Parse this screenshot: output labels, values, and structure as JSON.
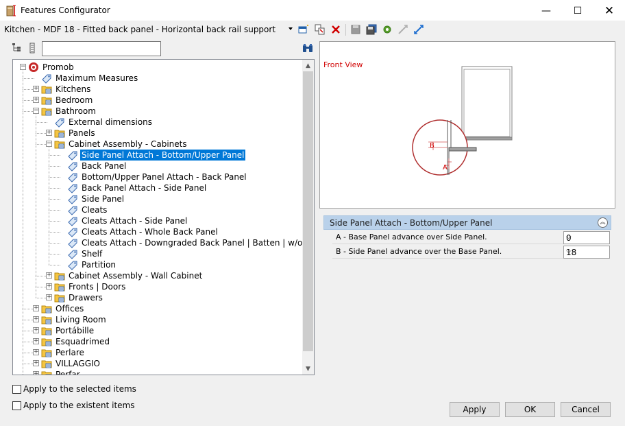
{
  "window": {
    "title": "Features Configurator",
    "minimize_glyph": "—",
    "maximize_glyph": "☐",
    "close_glyph": "✕"
  },
  "toolbar": {
    "config_name": "Kitchen - MDF 18 - Fitted back panel - Horizontal back rail support"
  },
  "tree": {
    "search_value": "",
    "nodes": [
      {
        "label": "Promob"
      },
      {
        "label": "Maximum Measures"
      },
      {
        "label": "Kitchens"
      },
      {
        "label": "Bedroom"
      },
      {
        "label": "Bathroom"
      },
      {
        "label": "External dimensions"
      },
      {
        "label": "Panels"
      },
      {
        "label": "Cabinet Assembly - Cabinets"
      },
      {
        "label": "Side Panel Attach - Bottom/Upper Panel"
      },
      {
        "label": "Back Panel"
      },
      {
        "label": " Bottom/Upper Panel Attach - Back Panel"
      },
      {
        "label": "Back Panel Attach - Side Panel"
      },
      {
        "label": "Side Panel"
      },
      {
        "label": "Cleats"
      },
      {
        "label": "Cleats Attach - Side Panel"
      },
      {
        "label": "Cleats Attach - Whole Back Panel"
      },
      {
        "label": "Cleats Attach - Downgraded Back Panel | Batten | w/o Back Panel"
      },
      {
        "label": "Shelf"
      },
      {
        "label": "Partition"
      },
      {
        "label": "Cabinet Assembly - Wall Cabinet"
      },
      {
        "label": "Fronts | Doors"
      },
      {
        "label": "Drawers"
      },
      {
        "label": "Offices"
      },
      {
        "label": "Living Room"
      },
      {
        "label": "Portábille"
      },
      {
        "label": "Esquadrimed"
      },
      {
        "label": "Perlare"
      },
      {
        "label": "VILLAGGIO"
      },
      {
        "label": "Perfar"
      }
    ]
  },
  "preview": {
    "view_label": "Front View",
    "dim_a": "A",
    "dim_b": "B"
  },
  "properties": {
    "header": "Side Panel Attach - Bottom/Upper Panel",
    "rows": [
      {
        "label": "A - Base Panel advance over Side Panel.",
        "value": "0"
      },
      {
        "label": "B - Side Panel advance over the Base Panel.",
        "value": "18"
      }
    ]
  },
  "options": {
    "apply_selected": "Apply to the selected items",
    "apply_existent": "Apply to the existent items"
  },
  "buttons": {
    "apply": "Apply",
    "ok": "OK",
    "cancel": "Cancel"
  },
  "colors": {
    "selection": "#0078d7",
    "accent_red": "#d00000",
    "props_header": "#b9d1ea"
  }
}
